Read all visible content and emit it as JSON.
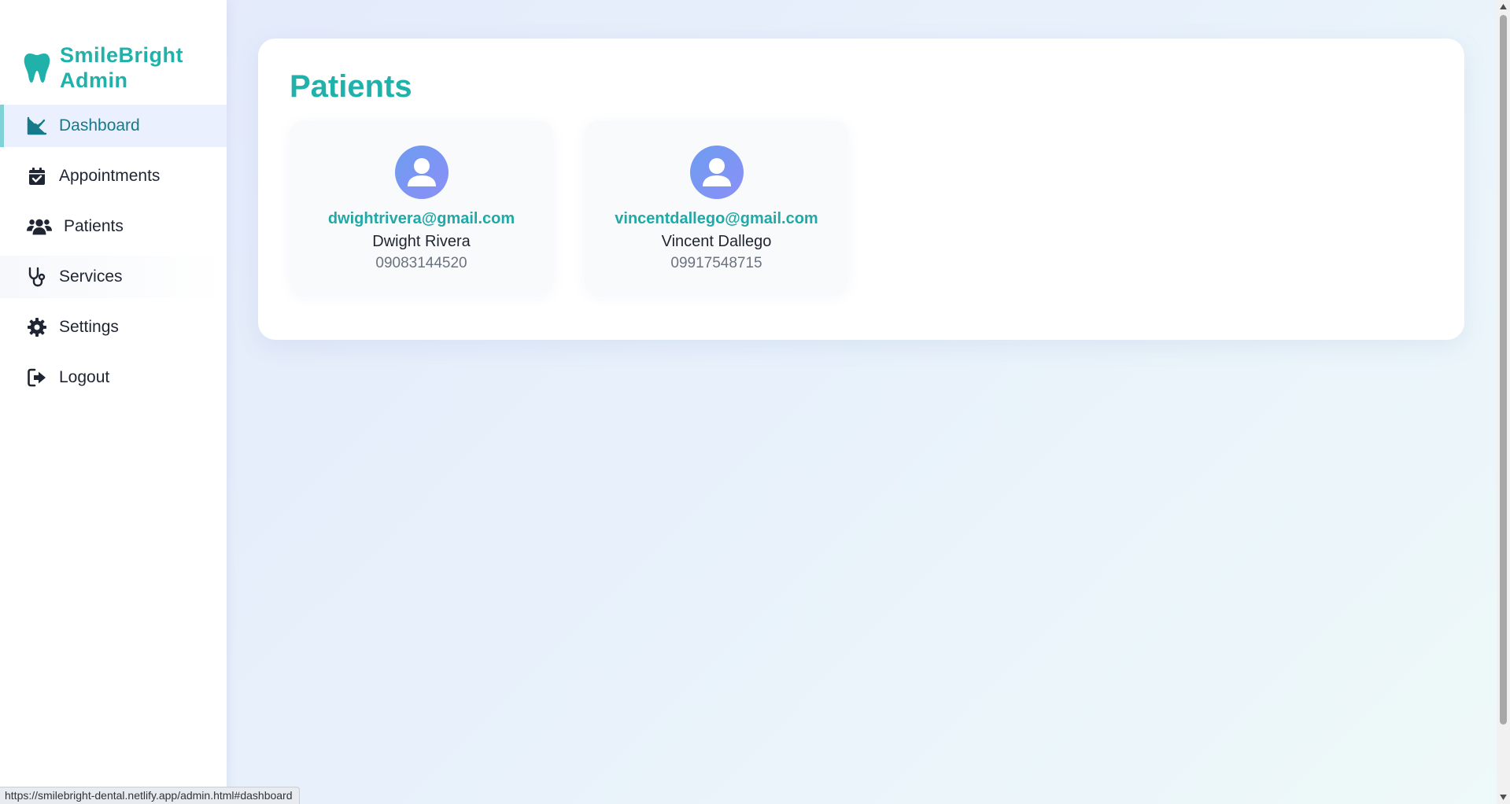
{
  "brand": {
    "line1": "SmileBright",
    "line2": "Admin",
    "icon": "tooth-icon"
  },
  "nav": [
    {
      "label": "Dashboard",
      "icon": "line-chart-icon",
      "active": true
    },
    {
      "label": "Appointments",
      "icon": "calendar-check-icon"
    },
    {
      "label": "Patients",
      "icon": "users-icon"
    },
    {
      "label": "Services",
      "icon": "stethoscope-icon"
    },
    {
      "label": "Settings",
      "icon": "gear-icon"
    },
    {
      "label": "Logout",
      "icon": "logout-icon"
    }
  ],
  "main": {
    "title": "Patients",
    "patients": [
      {
        "email": "dwightrivera@gmail.com",
        "name": "Dwight Rivera",
        "phone": "09083144520"
      },
      {
        "email": "vincentdallego@gmail.com",
        "name": "Vincent Dallego",
        "phone": "09917548715"
      }
    ]
  },
  "status_bar": {
    "url": "https://smilebright-dental.netlify.app/admin.html#dashboard"
  },
  "colors": {
    "accent": "#20b2aa",
    "active_bg": "#eaf0fd",
    "avatar": "#7a96f3"
  }
}
